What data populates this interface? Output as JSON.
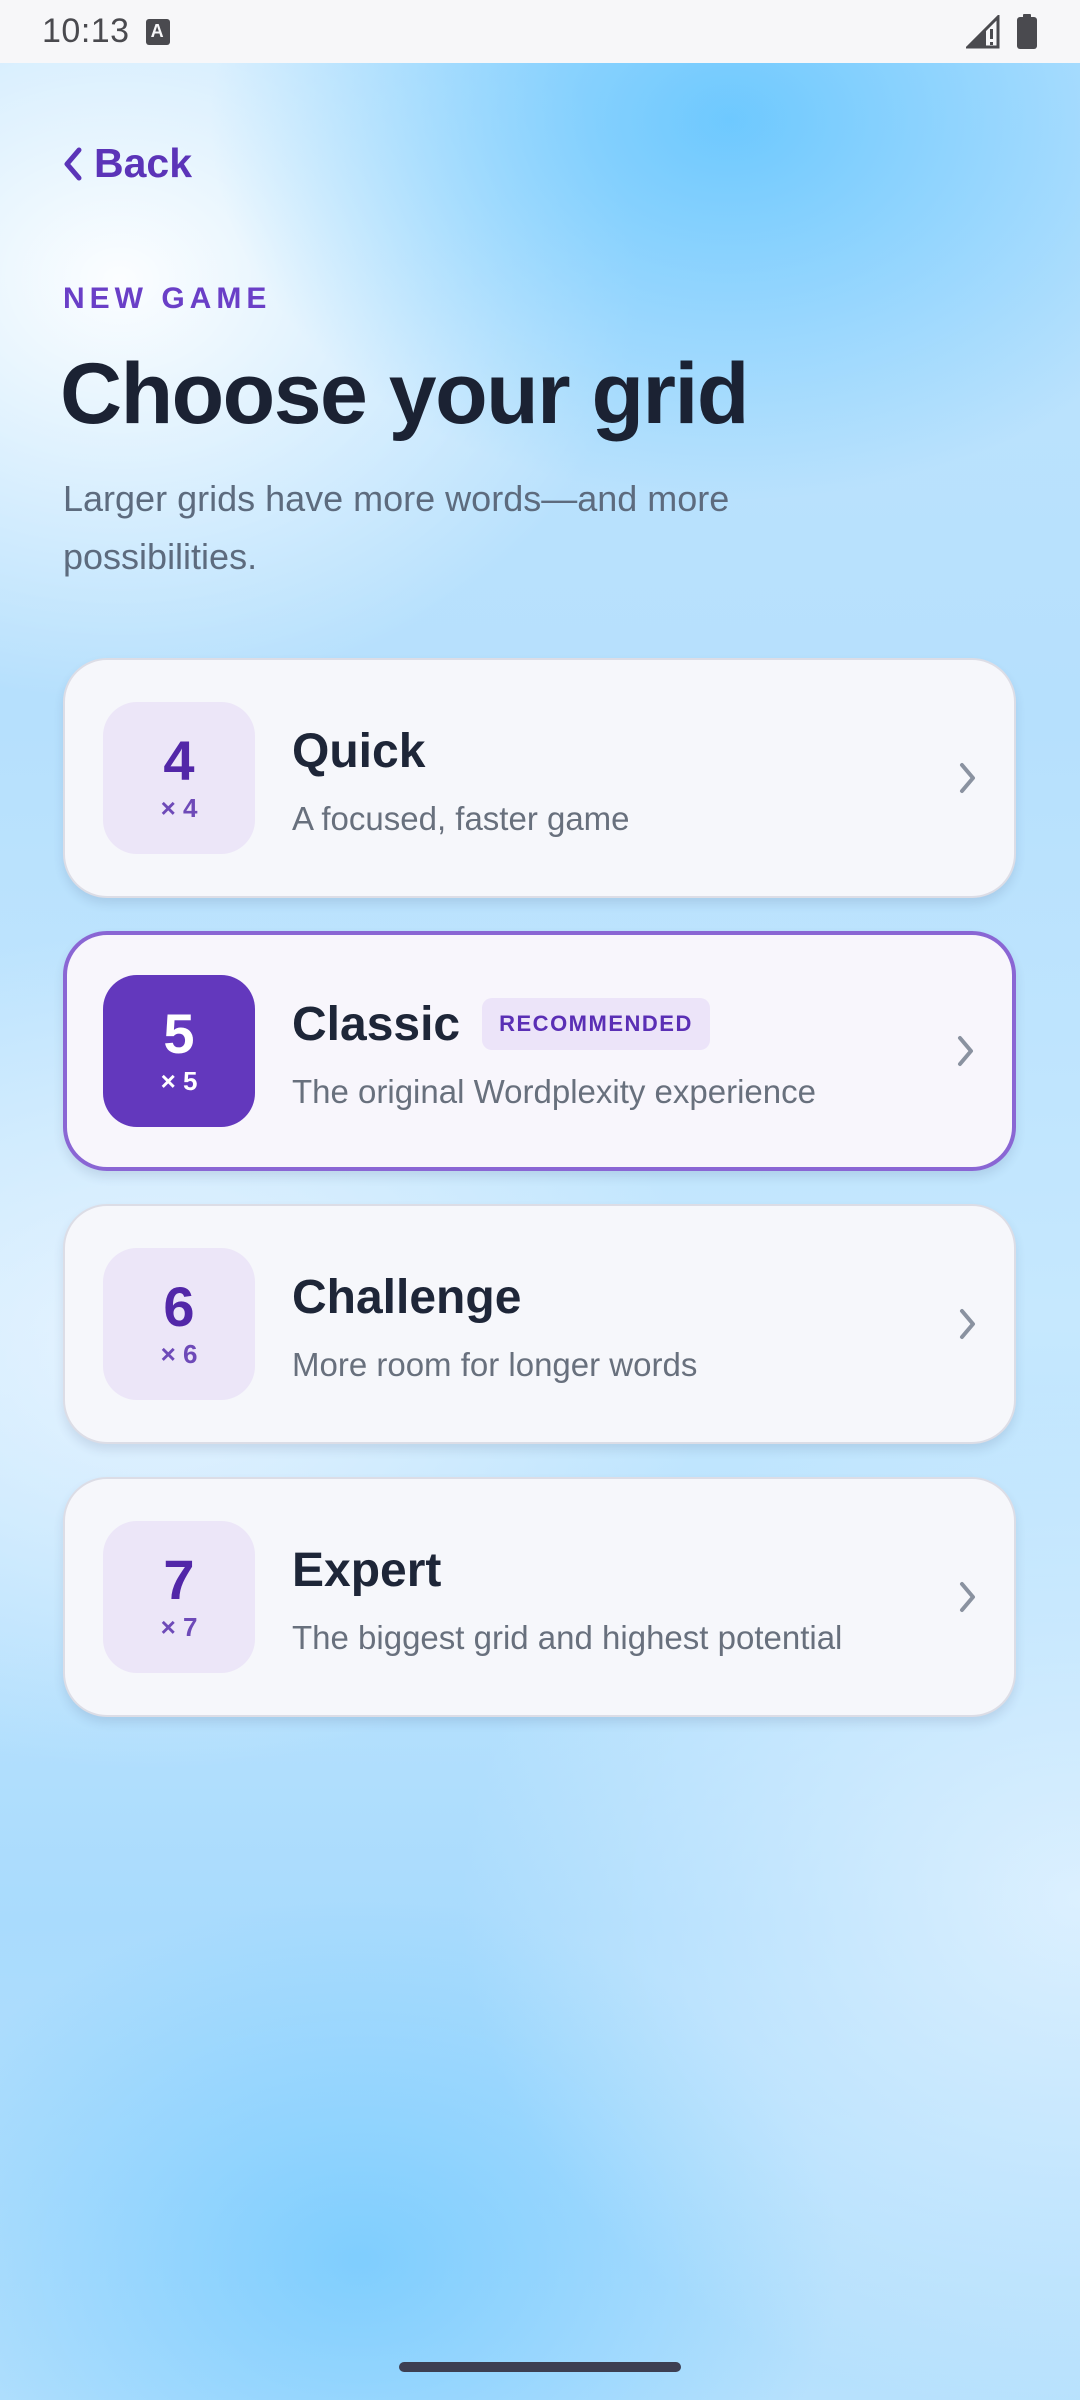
{
  "status_bar": {
    "time": "10:13",
    "icons": [
      "text-a-icon",
      "signal-icon",
      "battery-icon"
    ]
  },
  "header": {
    "back_label": "Back",
    "eyebrow": "NEW GAME",
    "title": "Choose your grid",
    "subtitle": "Larger grids have more words—and more possibilities."
  },
  "options": [
    {
      "size": "4",
      "size_sub": "× 4",
      "title": "Quick",
      "description": "A focused, faster game",
      "badge": null,
      "selected": false
    },
    {
      "size": "5",
      "size_sub": "× 5",
      "title": "Classic",
      "description": "The original Wordplexity experience",
      "badge": "RECOMMENDED",
      "selected": true
    },
    {
      "size": "6",
      "size_sub": "× 6",
      "title": "Challenge",
      "description": "More room for longer words",
      "badge": null,
      "selected": false
    },
    {
      "size": "7",
      "size_sub": "× 7",
      "title": "Expert",
      "description": "The biggest grid and highest potential",
      "badge": null,
      "selected": false
    }
  ],
  "colors": {
    "accent": "#6338bd",
    "badge_bg": "#ece6f8",
    "title_text": "#1b2233",
    "muted_text": "#5d6b7e"
  }
}
